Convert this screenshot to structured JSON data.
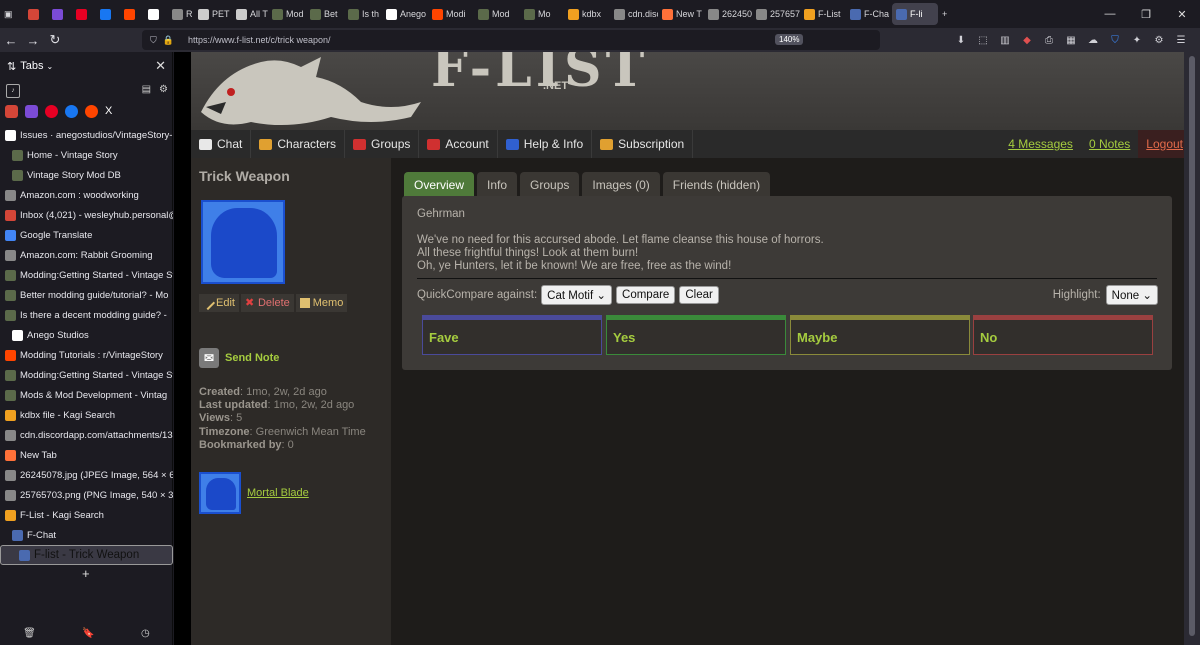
{
  "browser": {
    "tabs": [
      {
        "label": "",
        "color": "#d44638"
      },
      {
        "label": "",
        "color": "#7b4bd6"
      },
      {
        "label": "",
        "color": "#e60023"
      },
      {
        "label": "",
        "color": "#1877f2"
      },
      {
        "label": "",
        "color": "#ff4500"
      },
      {
        "label": "",
        "color": "#ffffff"
      },
      {
        "label": "R",
        "color": "#888888"
      },
      {
        "label": "PET R",
        "color": "#cccccc"
      },
      {
        "label": "All Th",
        "color": "#cccccc"
      },
      {
        "label": "Mod",
        "color": "#5b6a4a"
      },
      {
        "label": "Bet",
        "color": "#5b6a4a"
      },
      {
        "label": "Is th",
        "color": "#5b6a4a"
      },
      {
        "label": "Anego",
        "color": "#ffffff"
      },
      {
        "label": "Modi",
        "color": "#ff4500"
      },
      {
        "label": "Mod",
        "color": "#5b6a4a"
      },
      {
        "label": "Mo",
        "color": "#5b6a4a"
      },
      {
        "label": "kdbx",
        "color": "#f0a020"
      },
      {
        "label": "cdn.disco",
        "color": "#888888"
      },
      {
        "label": "New T",
        "color": "#ff7139"
      },
      {
        "label": "26245078.j",
        "color": "#888888"
      },
      {
        "label": "25765703.p",
        "color": "#888888"
      },
      {
        "label": "F-List",
        "color": "#f0a020"
      },
      {
        "label": "F-Cha",
        "color": "#4a6ab0"
      },
      {
        "label": "F-li",
        "color": "#4a6ab0"
      }
    ],
    "url": "https://www.f-list.net/c/trick weapon/",
    "zoom": "140%"
  },
  "sidebar": {
    "title": "Tabs",
    "items": [
      {
        "label": "Issues · anegostudios/VintageStory-I",
        "indent": 0,
        "color": "#ffffff"
      },
      {
        "label": "Home - Vintage Story",
        "indent": 1,
        "color": "#5b6a4a"
      },
      {
        "label": "Vintage Story Mod DB",
        "indent": 1,
        "color": "#5b6a4a"
      },
      {
        "label": "Amazon.com : woodworking",
        "indent": 0,
        "color": "#888888"
      },
      {
        "label": "Inbox (4,021) - wesleyhub.personal@",
        "indent": 0,
        "color": "#d44638"
      },
      {
        "label": "Google Translate",
        "indent": 0,
        "color": "#4285f4"
      },
      {
        "label": "Amazon.com: Rabbit Grooming",
        "indent": 0,
        "color": "#888888"
      },
      {
        "label": "Modding:Getting Started - Vintage Sto",
        "indent": 0,
        "color": "#5b6a4a"
      },
      {
        "label": "Better modding guide/tutorial? - Mo",
        "indent": 0,
        "color": "#5b6a4a"
      },
      {
        "label": "Is there a decent modding guide? -",
        "indent": 0,
        "color": "#5b6a4a"
      },
      {
        "label": "Anego Studios",
        "indent": 1,
        "color": "#ffffff"
      },
      {
        "label": "Modding Tutorials : r/VintageStory",
        "indent": 0,
        "color": "#ff4500"
      },
      {
        "label": "Modding:Getting Started - Vintage Sto",
        "indent": 0,
        "color": "#5b6a4a"
      },
      {
        "label": "Mods & Mod Development - Vintag",
        "indent": 0,
        "color": "#5b6a4a"
      },
      {
        "label": "kdbx file - Kagi Search",
        "indent": 0,
        "color": "#f0a020"
      },
      {
        "label": "cdn.discordapp.com/attachments/13",
        "indent": 0,
        "color": "#888888"
      },
      {
        "label": "New Tab",
        "indent": 0,
        "color": "#ff7139"
      },
      {
        "label": "26245078.jpg (JPEG Image, 564 × 69",
        "indent": 0,
        "color": "#888888"
      },
      {
        "label": "25765703.png (PNG Image, 540 × 37",
        "indent": 0,
        "color": "#888888"
      },
      {
        "label": "F-List - Kagi Search",
        "indent": 0,
        "color": "#f0a020"
      },
      {
        "label": "F-Chat",
        "indent": 1,
        "color": "#4a6ab0"
      },
      {
        "label": "F-list - Trick Weapon",
        "indent": 2,
        "color": "#4a6ab0"
      }
    ]
  },
  "site": {
    "logo": "F-LIST",
    "logo_net": ".NET",
    "menu": [
      {
        "label": "Chat",
        "color": "#e8e8e8"
      },
      {
        "label": "Characters",
        "color": "#e0a030"
      },
      {
        "label": "Groups",
        "color": "#d03030"
      },
      {
        "label": "Account",
        "color": "#d03030"
      },
      {
        "label": "Help & Info",
        "color": "#3060d0"
      },
      {
        "label": "Subscription",
        "color": "#e0a030"
      }
    ],
    "messages": "4 Messages",
    "notes": "0 Notes",
    "logout": "Logout"
  },
  "character": {
    "name": "Trick Weapon",
    "actions": {
      "edit": "Edit",
      "delete": "Delete",
      "memo": "Memo"
    },
    "send_note": "Send Note",
    "info": [
      {
        "key": "Created",
        "value": "1mo, 2w, 2d ago"
      },
      {
        "key": "Last updated",
        "value": "1mo, 2w, 2d ago"
      },
      {
        "key": "Views",
        "value": "5"
      },
      {
        "key": "Timezone",
        "value": "Greenwich Mean Time"
      },
      {
        "key": "Bookmarked by",
        "value": "0"
      }
    ],
    "friend": "Mortal Blade"
  },
  "profile": {
    "tabs": [
      "Overview",
      "Info",
      "Groups",
      "Images (0)",
      "Friends (hidden)"
    ],
    "intro": "Gehrman",
    "lines": [
      "We've no need for this accursed abode. Let flame cleanse this house of horrors.",
      "All these frightful things! Look at them burn!",
      "Oh, ye Hunters, let it be known! We are free, free as the wind!"
    ],
    "quickcompare_label": "QuickCompare against:",
    "quickcompare_value": "Cat Motif",
    "compare": "Compare",
    "clear": "Clear",
    "highlight_label": "Highlight:",
    "highlight_value": "None",
    "kinks": [
      {
        "label": "Fave",
        "color": "#4a4a9a"
      },
      {
        "label": "Yes",
        "color": "#3a8a3a"
      },
      {
        "label": "Maybe",
        "color": "#8a8a3a"
      },
      {
        "label": "No",
        "color": "#9a4040"
      }
    ]
  }
}
